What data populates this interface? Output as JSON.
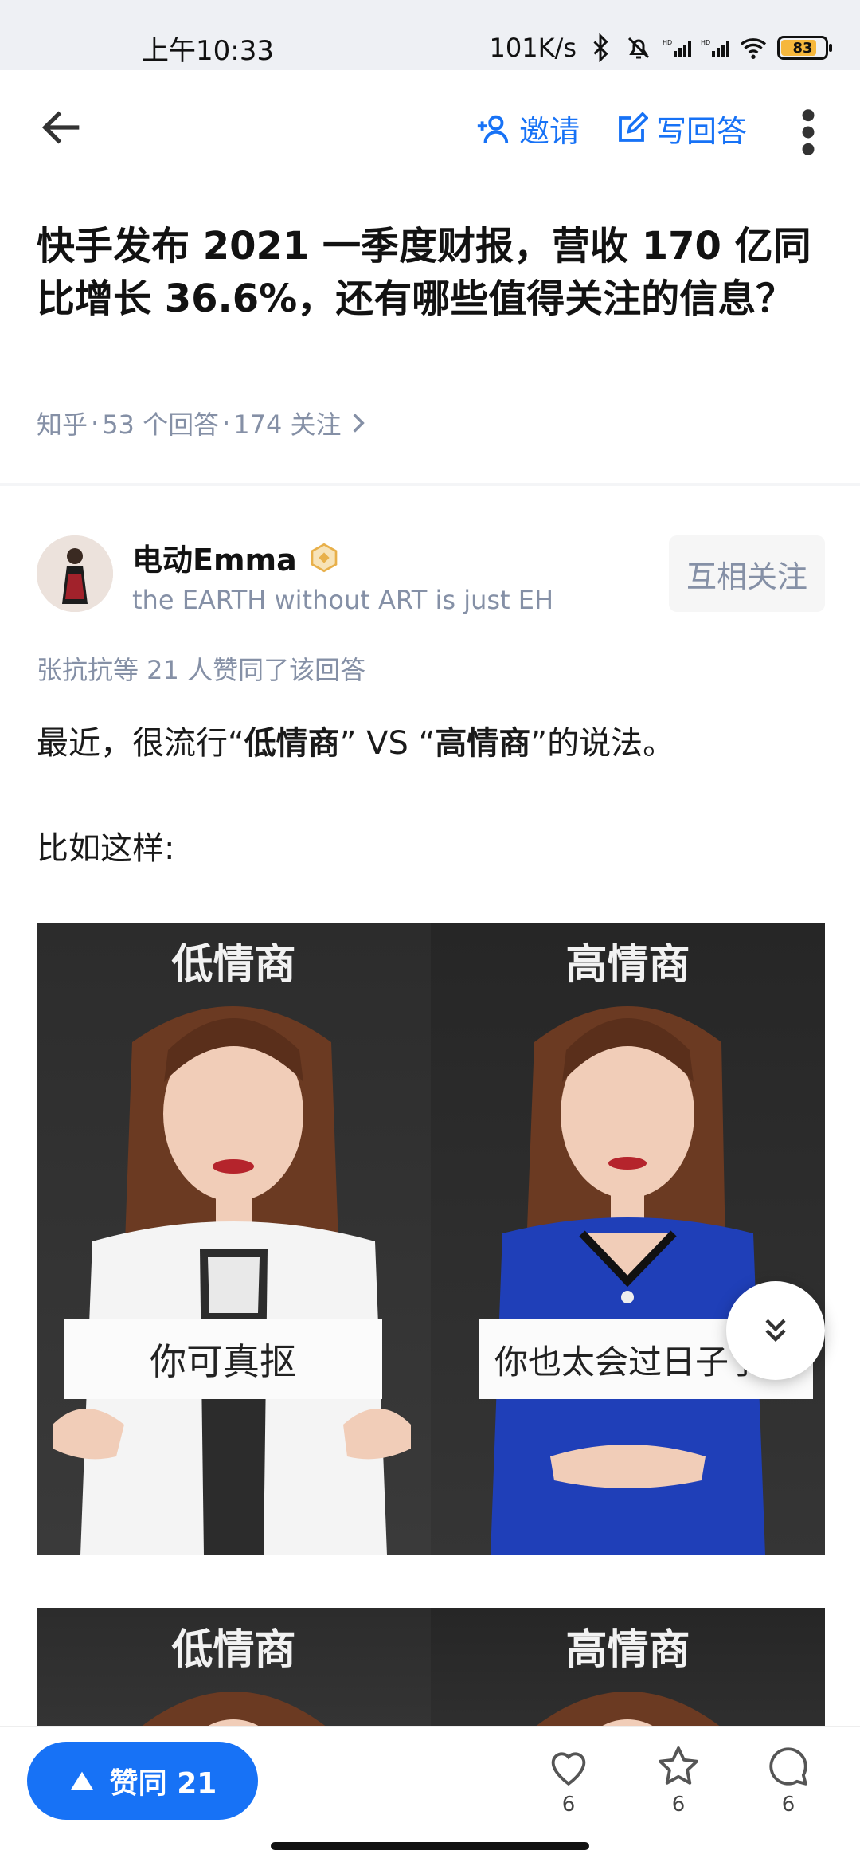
{
  "status_bar": {
    "time": "上午10:33",
    "network_speed": "101K/s",
    "battery_level": "83",
    "battery_percent": 83
  },
  "nav": {
    "invite_label": "邀请",
    "write_answer_label": "写回答"
  },
  "question": {
    "title": "快手发布 2021 一季度财报，营收 170 亿同比增长 36.6%，还有哪些值得关注的信息？",
    "source": "知乎",
    "answers_count": "53 个回答",
    "follows_count": "174 关注"
  },
  "author": {
    "name": "电动Emma",
    "bio": "the EARTH without ART is just EH",
    "follow_label": "互相关注"
  },
  "vote_info": "张抗抗等 21 人赞同了该回答",
  "answer": {
    "p1_prefix": "最近，很流行“",
    "p1_low": "低情商",
    "p1_mid": "” VS “",
    "p1_high": "高情商",
    "p1_suffix": "”的说法。",
    "p2": "比如这样:"
  },
  "meme": {
    "left_heading": "低情商",
    "right_heading": "高情商",
    "left_caption": "你可真抠",
    "right_caption": "你也太会过日子了吧"
  },
  "bottom_bar": {
    "upvote_label": "赞同 21",
    "like_count": "6",
    "favorite_count": "6",
    "comment_count": "6"
  },
  "colors": {
    "accent": "#1772f6",
    "meta_gray": "#8590a6",
    "badge_gold": "#e8b04a"
  },
  "icons": {
    "back": "arrow-left-icon",
    "invite": "add-user-icon",
    "write": "edit-icon",
    "more": "more-vertical-icon",
    "badge": "hexagon-badge-icon",
    "scroll": "double-chevron-down-icon",
    "upvote": "triangle-up-icon",
    "like": "heart-icon",
    "favorite": "star-icon",
    "comment": "comment-icon"
  }
}
